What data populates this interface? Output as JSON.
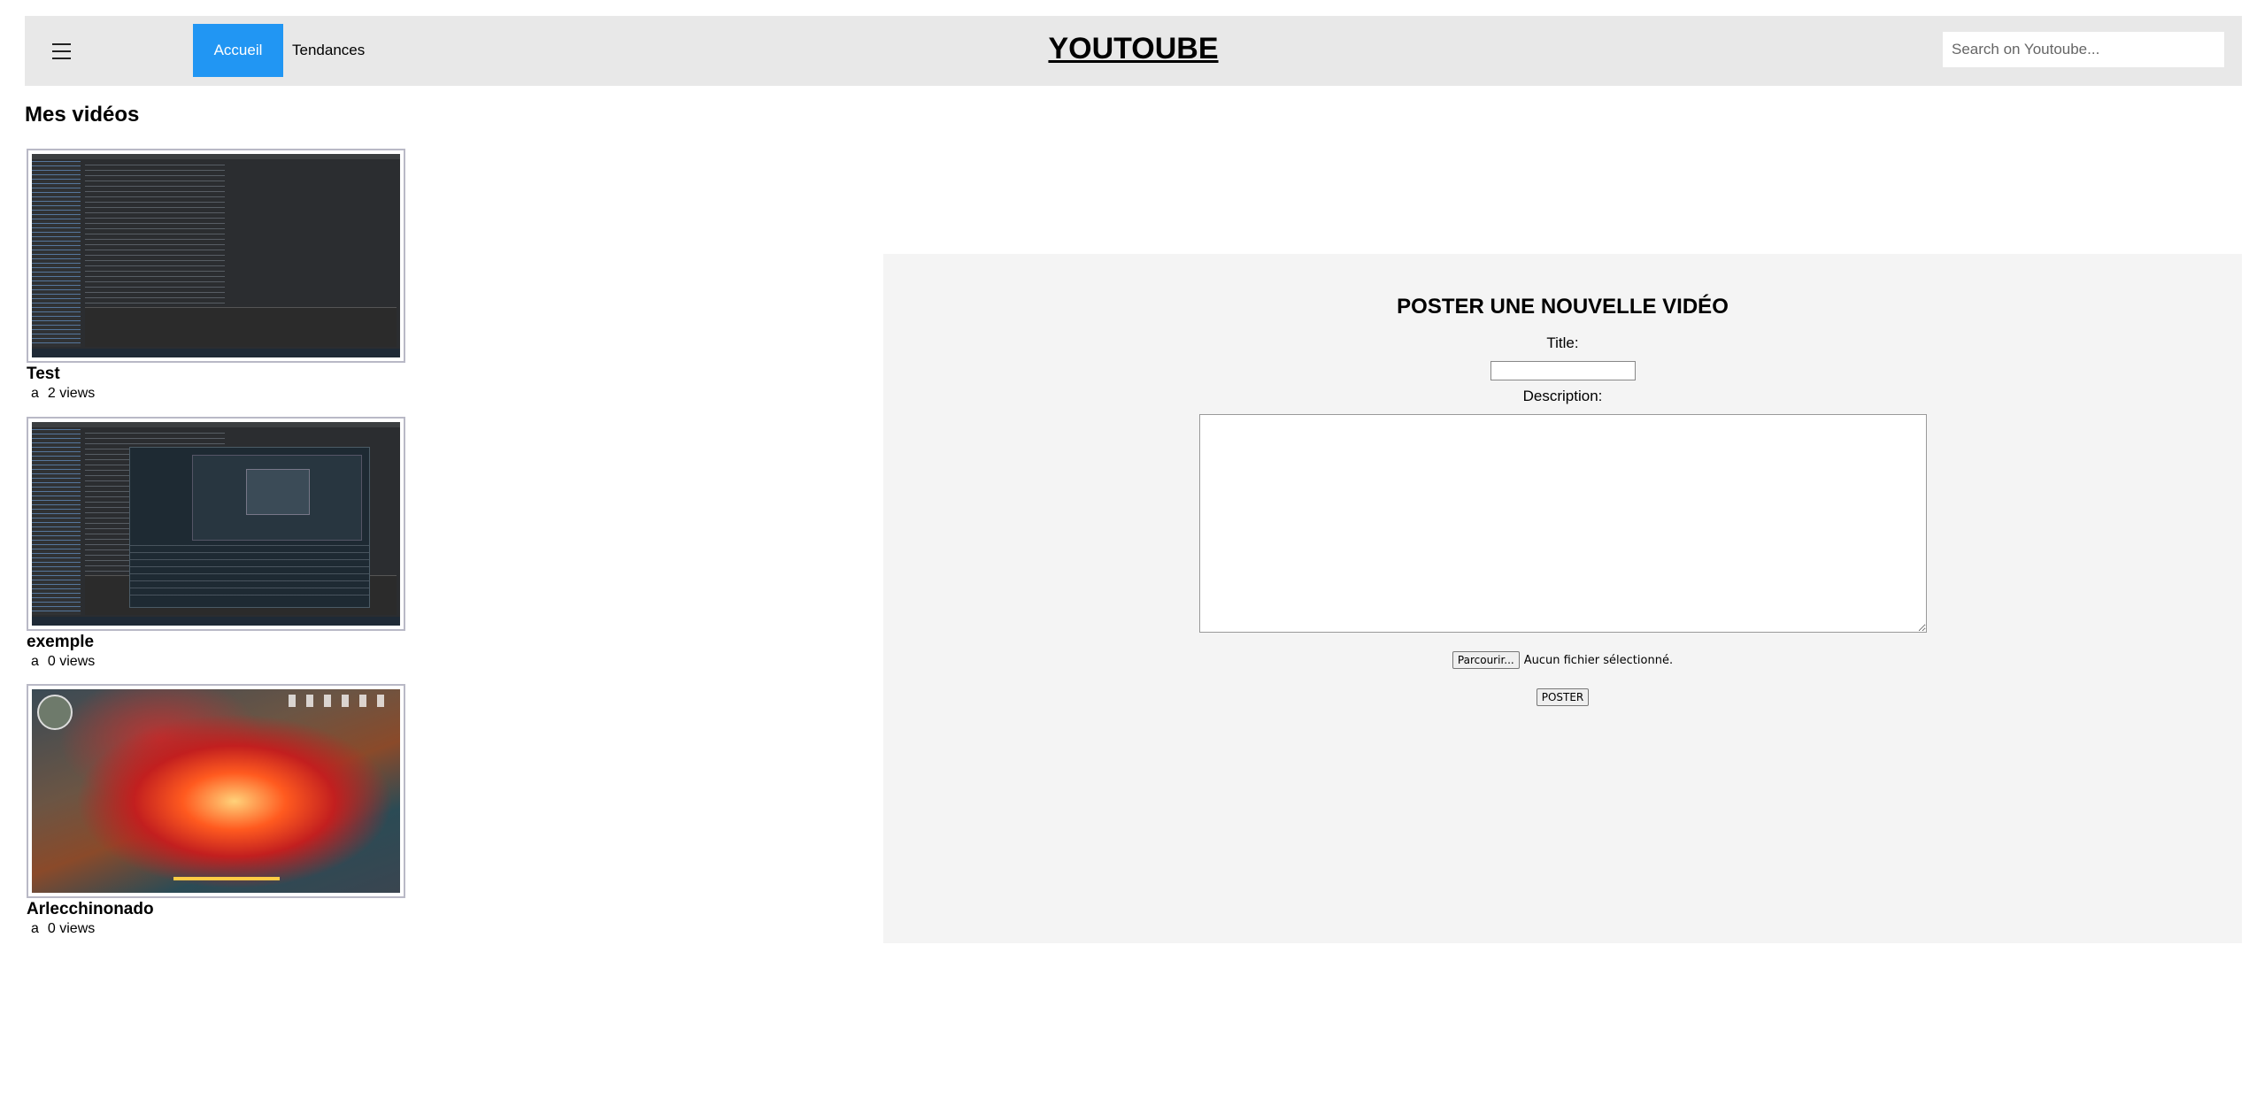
{
  "header": {
    "menu_icon": "hamburger-menu-icon",
    "nav": {
      "home": "Accueil",
      "trends": "Tendances"
    },
    "brand": "YOUTOUBE",
    "search_placeholder": "Search on Youtoube...",
    "active_color": "#2196f3"
  },
  "main": {
    "section_title": "Mes vidéos",
    "videos": [
      {
        "title": "Test",
        "author": "a",
        "views": "2 views",
        "thumbnail": "ide-screenshot"
      },
      {
        "title": "exemple",
        "author": "a",
        "views": "0 views",
        "thumbnail": "ide-with-recorder-screenshot"
      },
      {
        "title": "Arlecchinonado",
        "author": "a",
        "views": "0 views",
        "thumbnail": "game-screenshot"
      }
    ]
  },
  "upload": {
    "heading": "POSTER UNE NOUVELLE VIDÉO",
    "title_label": "Title:",
    "title_value": "",
    "description_label": "Description:",
    "description_value": "",
    "browse_button": "Parcourir...",
    "file_status": "Aucun fichier sélectionné.",
    "submit_button": "POSTER"
  }
}
